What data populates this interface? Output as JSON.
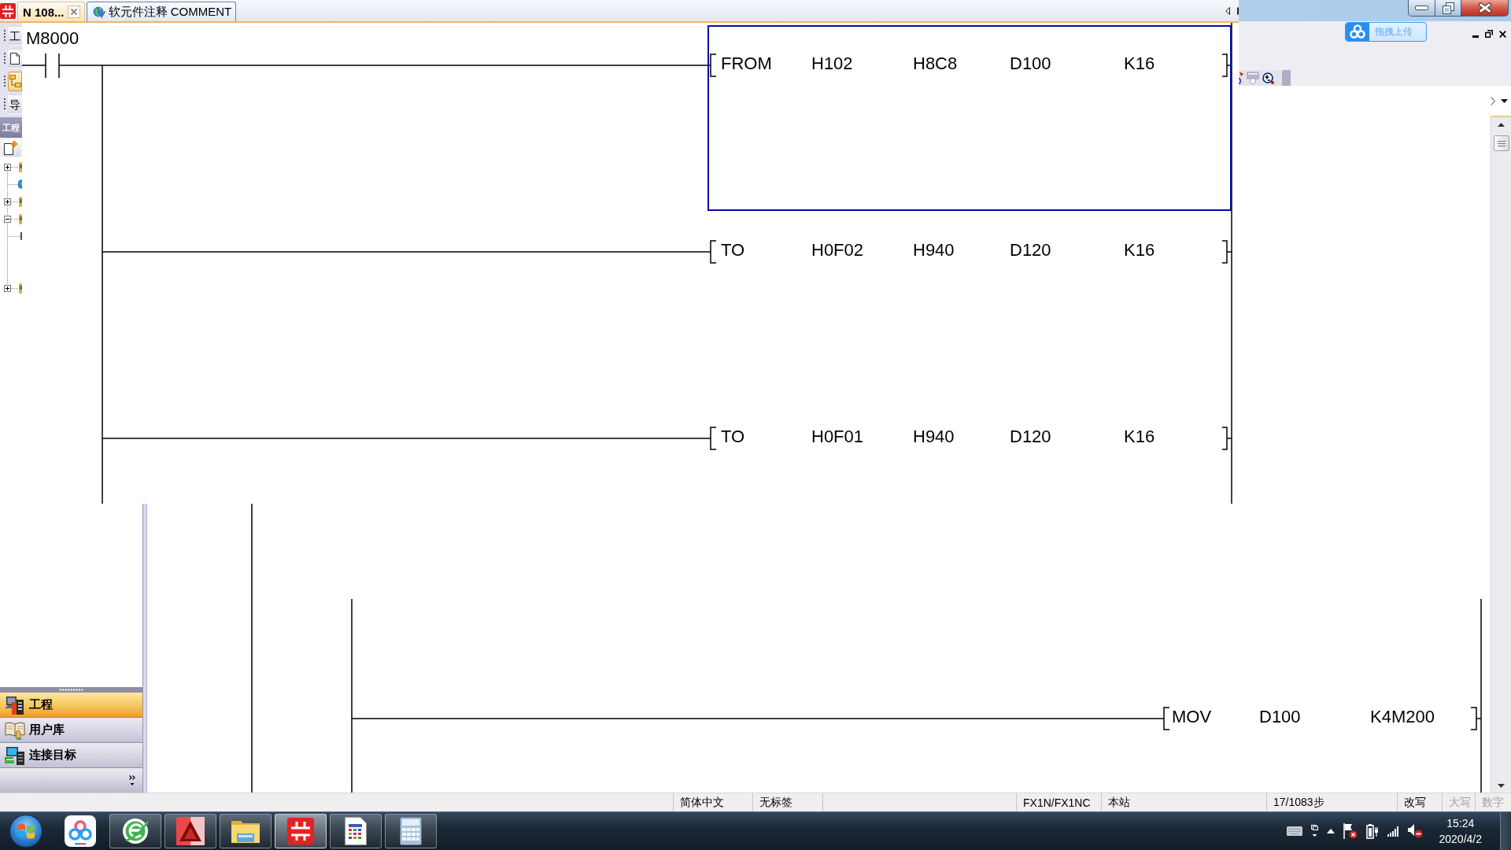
{
  "editor_window": {
    "tabs": [
      {
        "kind": "program",
        "label": "N 108...",
        "selected": true,
        "closable": true
      },
      {
        "kind": "comment",
        "label": "软元件注释 COMMENT",
        "selected": false,
        "closable": false
      }
    ],
    "side_toolbar": [
      {
        "kind": "text",
        "label": "工",
        "selected": false
      },
      {
        "kind": "page",
        "selected": false
      },
      {
        "kind": "tree",
        "selected": true
      },
      {
        "kind": "text",
        "label": "导",
        "selected": false
      }
    ],
    "panel_header": "工程",
    "project_tree": [
      {
        "kind": "branch",
        "expanded": false
      },
      {
        "kind": "leaf"
      },
      {
        "kind": "branch",
        "expanded": false
      },
      {
        "kind": "branch",
        "expanded": true,
        "children": [
          {
            "kind": "leaf"
          }
        ]
      },
      {
        "kind": "branch",
        "expanded": false
      }
    ],
    "ladder": {
      "contact": "M8000",
      "rungs": [
        {
          "selected": true,
          "instruction": "FROM",
          "operands": [
            "H102",
            "H8C8",
            "D100",
            "K16"
          ]
        },
        {
          "selected": false,
          "instruction": "TO",
          "operands": [
            "H0F02",
            "H940",
            "D120",
            "K16"
          ]
        },
        {
          "selected": false,
          "instruction": "TO",
          "operands": [
            "H0F01",
            "H940",
            "D120",
            "K16"
          ]
        }
      ]
    }
  },
  "main_window": {
    "upload_widget": {
      "label": "拖拽上传"
    },
    "navigation": [
      {
        "kind": "project",
        "label": "工程",
        "selected": true
      },
      {
        "kind": "library",
        "label": "用户库",
        "selected": false
      },
      {
        "kind": "connection",
        "label": "连接目标",
        "selected": false
      }
    ],
    "ladder": {
      "instruction": "MOV",
      "operands": [
        "D100",
        "K4M200"
      ]
    }
  },
  "status_bar": [
    {
      "text": "简体中文",
      "disabled": false
    },
    {
      "text": "无标签",
      "disabled": false
    },
    {
      "text": "FX1N/FX1NC",
      "disabled": false
    },
    {
      "text": "本站",
      "disabled": false
    },
    {
      "text": "17/1083步",
      "disabled": false
    },
    {
      "text": "改写",
      "disabled": false
    },
    {
      "text": "大写",
      "disabled": true
    },
    {
      "text": "数字",
      "disabled": true
    }
  ],
  "taskbar": {
    "apps": [
      {
        "kind": "cloud",
        "running": false,
        "active": false
      },
      {
        "kind": "browser",
        "running": true,
        "active": false
      },
      {
        "kind": "cad",
        "running": true,
        "active": false
      },
      {
        "kind": "folder",
        "running": true,
        "active": false
      },
      {
        "kind": "plc",
        "running": true,
        "active": true
      },
      {
        "kind": "document",
        "running": true,
        "active": false
      },
      {
        "kind": "calculator",
        "running": true,
        "active": false
      }
    ],
    "time": "15:24",
    "date": "2020/4/2"
  }
}
